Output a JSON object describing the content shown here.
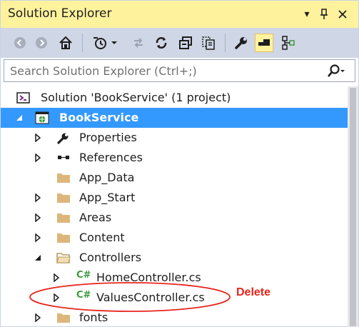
{
  "window": {
    "title": "Solution Explorer",
    "title_buttons": {
      "dropdown": "▾",
      "pin": "⊥",
      "close": "✕"
    }
  },
  "colors": {
    "accent_yellow": "#fff29d",
    "toolbar_bg": "#cfd6e5",
    "selection": "#3399ff",
    "csharp_green": "#3b9a3b",
    "folder": "#dcb67a",
    "annotation_red": "#e8241b"
  },
  "toolbar": {
    "icons": [
      "back-icon",
      "forward-icon",
      "home-icon",
      "history-clock-icon",
      "dropdown-arrow-icon",
      "sync-icon",
      "refresh-icon",
      "collapse-all-icon",
      "show-all-files-icon",
      "properties-wrench-icon",
      "preview-toggle-icon",
      "class-view-icon"
    ]
  },
  "search": {
    "placeholder": "Search Solution Explorer (Ctrl+;)",
    "value": "",
    "icon": "search-icon"
  },
  "tree": {
    "solution": "Solution 'BookService' (1 project)",
    "project": "BookService",
    "items": [
      {
        "label": "Properties",
        "icon": "wrench-icon"
      },
      {
        "label": "References",
        "icon": "references-icon"
      },
      {
        "label": "App_Data",
        "icon": "folder-icon"
      },
      {
        "label": "App_Start",
        "icon": "folder-icon"
      },
      {
        "label": "Areas",
        "icon": "folder-icon"
      },
      {
        "label": "Content",
        "icon": "folder-icon"
      },
      {
        "label": "Controllers",
        "icon": "folder-open-icon"
      }
    ],
    "controllers_children": [
      {
        "label": "HomeController.cs",
        "icon": "csharp-file-icon"
      },
      {
        "label": "ValuesController.cs",
        "icon": "csharp-file-icon"
      }
    ],
    "after": [
      {
        "label": "fonts",
        "icon": "folder-icon"
      }
    ],
    "csharp_glyph": "C#"
  },
  "annotation": {
    "label": "Delete"
  }
}
